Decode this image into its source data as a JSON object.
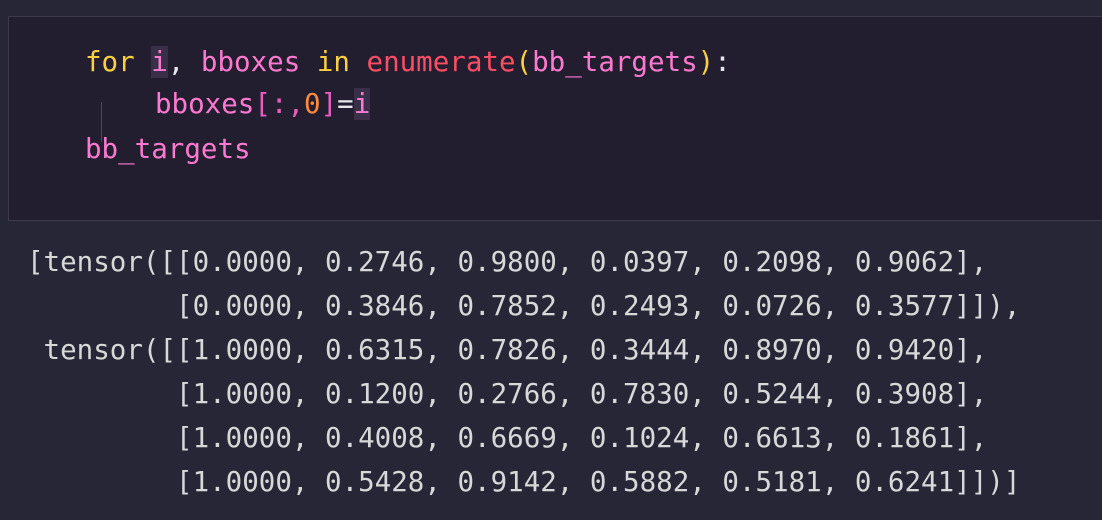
{
  "code": {
    "line1": {
      "kw_for": "for",
      "var_i": "i",
      "comma": ",",
      "var_bboxes": "bboxes",
      "kw_in": "in",
      "fn_enumerate": "enumerate",
      "paren_open": "(",
      "arg": "bb_targets",
      "paren_close": ")",
      "colon": ":"
    },
    "line2": {
      "var_bboxes": "bboxes",
      "bracket_open": "[",
      "slice": ":,",
      "zero": "0",
      "bracket_close": "]",
      "equals": "=",
      "var_i": "i"
    },
    "line3": {
      "var_bb_targets": "bb_targets"
    }
  },
  "output": {
    "lines": [
      "[tensor([[0.0000, 0.2746, 0.9800, 0.0397, 0.2098, 0.9062],",
      "         [0.0000, 0.3846, 0.7852, 0.2493, 0.0726, 0.3577]]),",
      " tensor([[1.0000, 0.6315, 0.7826, 0.3444, 0.8970, 0.9420],",
      "         [1.0000, 0.1200, 0.2766, 0.7830, 0.5244, 0.3908],",
      "         [1.0000, 0.4008, 0.6669, 0.1024, 0.6613, 0.1861],",
      "         [1.0000, 0.5428, 0.9142, 0.5882, 0.5181, 0.6241]])]"
    ]
  }
}
